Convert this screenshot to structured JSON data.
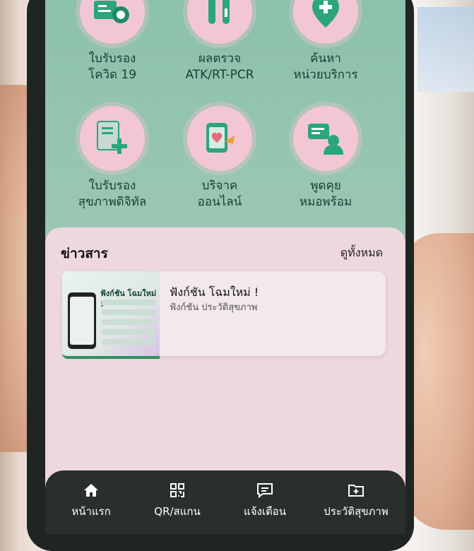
{
  "menu": {
    "items": [
      {
        "label": "ใบรับรอง\nโควิด 19",
        "icon": "covid-certificate-icon"
      },
      {
        "label": "ผลตรวจ\nATK/RT-PCR",
        "icon": "test-tube-icon"
      },
      {
        "label": "ค้นหา\nหน่วยบริการ",
        "icon": "location-pin-icon"
      },
      {
        "label": "ใบรับรอง\nสุขภาพดิจิทัล",
        "icon": "document-add-icon"
      },
      {
        "label": "บริจาค\nออนไลน์",
        "icon": "donate-heart-icon"
      },
      {
        "label": "พูดคุย\nหมอพร้อม",
        "icon": "chat-doctor-icon"
      }
    ]
  },
  "news": {
    "header": "ข่าวสาร",
    "view_all": "ดูทั้งหมด",
    "articles": [
      {
        "title": "ฟังก์ชัน โฉมใหม่ !",
        "subtitle": "ฟังก์ชัน ประวัติสุขภาพ",
        "thumb_title": "ฟังก์ชัน โฉมใหม่ !"
      }
    ]
  },
  "nav": {
    "items": [
      {
        "label": "หน้าแรก",
        "icon": "home-icon"
      },
      {
        "label": "QR/สแกน",
        "icon": "qr-scan-icon"
      },
      {
        "label": "แจ้งเตือน",
        "icon": "notification-message-icon"
      },
      {
        "label": "ประวัติสุขภาพ",
        "icon": "health-folder-icon"
      }
    ]
  },
  "colors": {
    "screen_bg": "#8cc1ab",
    "icon_circle": "#f2c7d3",
    "icon_primary": "#2aa57e",
    "news_card_bg": "#efd7df",
    "bottom_nav_bg": "#2a2f2d"
  }
}
